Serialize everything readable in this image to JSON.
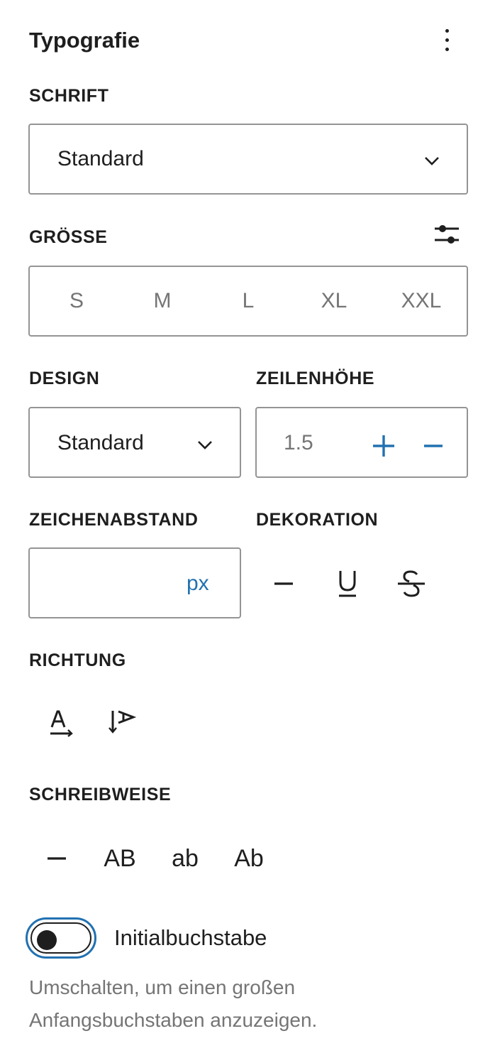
{
  "panel": {
    "title": "Typografie",
    "menu_icon": "more-vertical-icon"
  },
  "font": {
    "label": "SCHRIFT",
    "value": "Standard"
  },
  "size": {
    "label": "GRÖSSE",
    "custom_icon": "settings-sliders-icon",
    "options": [
      "S",
      "M",
      "L",
      "XL",
      "XXL"
    ]
  },
  "appearance": {
    "label": "DESIGN",
    "value": "Standard"
  },
  "line_height": {
    "label": "ZEILENHÖHE",
    "value": "1.5",
    "increment_icon": "plus-icon",
    "decrement_icon": "minus-icon"
  },
  "letter_spacing": {
    "label": "ZEICHENABSTAND",
    "value": "",
    "unit": "px"
  },
  "decoration": {
    "label": "DEKORATION",
    "options": [
      {
        "name": "none",
        "icon": "reset-minus-icon"
      },
      {
        "name": "underline",
        "icon": "underline-icon"
      },
      {
        "name": "strikethrough",
        "icon": "strikethrough-icon"
      }
    ]
  },
  "direction": {
    "label": "RICHTUNG",
    "options": [
      {
        "name": "horizontal",
        "icon": "text-horizontal-icon"
      },
      {
        "name": "vertical",
        "icon": "text-vertical-icon"
      }
    ]
  },
  "text_transform": {
    "label": "SCHREIBWEISE",
    "options": [
      "—",
      "AB",
      "ab",
      "Ab"
    ]
  },
  "drop_cap": {
    "label": "Initialbuchstabe",
    "enabled": false,
    "help": "Umschalten, um einen großen Anfangsbuchstaben anzuzeigen."
  },
  "colors": {
    "accent": "#2271b1",
    "text": "#1e1e1e",
    "muted": "#757575",
    "border": "#949494"
  }
}
